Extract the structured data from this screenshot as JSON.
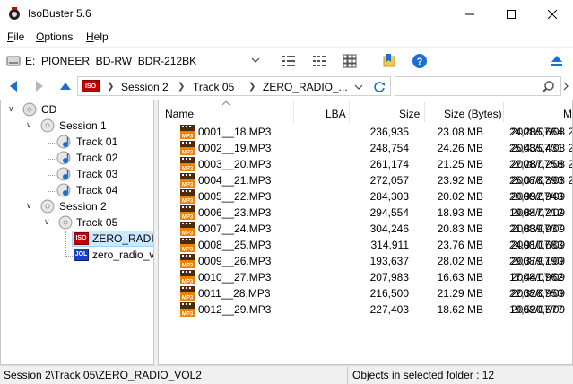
{
  "window": {
    "title": "IsoBuster 5.6",
    "minimize": "minimize",
    "maximize": "maximize",
    "close": "close"
  },
  "menu": {
    "items": [
      {
        "label": "File"
      },
      {
        "label": "Options"
      },
      {
        "label": "Help"
      }
    ]
  },
  "drive": {
    "selected": "E:  PIONEER  BD-RW  BDR-212BK"
  },
  "toolbar_icons": [
    "list-view-icon",
    "details-view-icon",
    "thumbnail-view-icon",
    "bookmark-folder-icon",
    "help-icon",
    "eject-icon"
  ],
  "breadcrumb": {
    "badge": "ISO",
    "items": [
      {
        "label": "Session 2"
      },
      {
        "label": "Track 05"
      },
      {
        "label": "ZERO_RADIO_..."
      }
    ]
  },
  "tree": {
    "items": [
      {
        "label": "CD"
      },
      {
        "label": "Session 1"
      },
      {
        "label": "Track 01"
      },
      {
        "label": "Track 02"
      },
      {
        "label": "Track 03"
      },
      {
        "label": "Track 04"
      },
      {
        "label": "Session 2"
      },
      {
        "label": "Track 05"
      },
      {
        "label": "ZERO_RADIO",
        "badge": "ISO"
      },
      {
        "label": "zero_radio_vo",
        "badge": "JOL"
      }
    ]
  },
  "list": {
    "columns": [
      "Name",
      "LBA",
      "Size",
      "Size (Bytes)",
      "M"
    ],
    "icon_badge": "MP3",
    "rows": [
      {
        "name": "0001__18.MP3",
        "lba": "236,935",
        "size": "23.08 MB",
        "bytes": "24,205,664",
        "date": "2008/07/08 2"
      },
      {
        "name": "0002__19.MP3",
        "lba": "248,754",
        "size": "24.26 MB",
        "bytes": "25,435,431",
        "date": "2008/07/08 2"
      },
      {
        "name": "0003__20.MP3",
        "lba": "261,174",
        "size": "21.25 MB",
        "bytes": "22,287,258",
        "date": "2008/07/08 2"
      },
      {
        "name": "0004__21.MP3",
        "lba": "272,057",
        "size": "23.92 MB",
        "bytes": "25,078,390",
        "date": "2008/07/08 2"
      },
      {
        "name": "0005__22.MP3",
        "lba": "284,303",
        "size": "20.02 MB",
        "bytes": "20,992,943",
        "date": "2008/07/09"
      },
      {
        "name": "0006__23.MP3",
        "lba": "294,554",
        "size": "18.93 MB",
        "bytes": "19,847,212",
        "date": "2008/07/09"
      },
      {
        "name": "0007__24.MP3",
        "lba": "304,246",
        "size": "20.83 MB",
        "bytes": "21,839,937",
        "date": "2008/07/09"
      },
      {
        "name": "0008__25.MP3",
        "lba": "314,911",
        "size": "23.76 MB",
        "bytes": "24,910,683",
        "date": "2008/07/09"
      },
      {
        "name": "0009__26.MP3",
        "lba": "193,637",
        "size": "28.02 MB",
        "bytes": "29,379,190",
        "date": "2008/07/09"
      },
      {
        "name": "0010__27.MP3",
        "lba": "207,983",
        "size": "16.63 MB",
        "bytes": "17,441,962",
        "date": "2008/07/09"
      },
      {
        "name": "0011__28.MP3",
        "lba": "216,500",
        "size": "21.29 MB",
        "bytes": "22,328,950",
        "date": "2008/07/09"
      },
      {
        "name": "0012__29.MP3",
        "lba": "227,403",
        "size": "18.62 MB",
        "bytes": "19,520,577",
        "date": "2008/07/09"
      }
    ]
  },
  "status": {
    "path": "Session 2\\Track 05\\ZERO_RADIO_VOL2",
    "count_text": "Objects in selected folder : 12"
  },
  "colors": {
    "accent_blue": "#0a64c8",
    "selection": "#cce8ff",
    "iso_red": "#c00000",
    "jol_blue": "#1a3ec8",
    "mp3_orange": "#f08000"
  }
}
